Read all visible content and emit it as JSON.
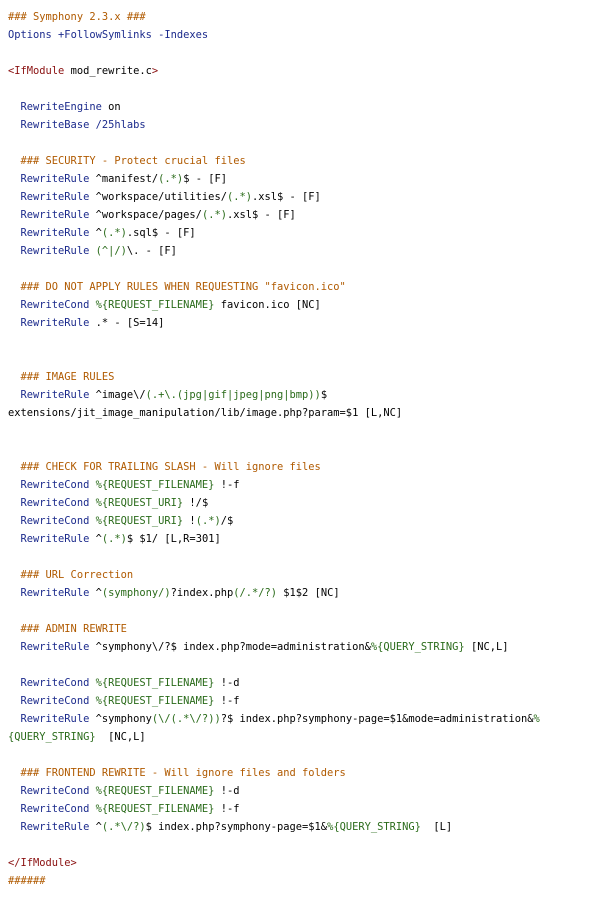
{
  "colors": {
    "comment": "#b05a00",
    "directive": "#1b2a8c",
    "variable": "#2a6b1a",
    "tag": "#8a1010",
    "text": "#000000",
    "background": "#ffffff"
  },
  "lines": [
    [
      {
        "t": "### Symphony 2.3.x ###",
        "c": "c"
      }
    ],
    [
      {
        "t": "Options",
        "c": "d"
      },
      {
        "t": " +FollowSymlinks -Indexes",
        "c": "d"
      }
    ],
    [],
    [
      {
        "t": "<IfModule",
        "c": "k"
      },
      {
        "t": " mod_rewrite.c",
        "c": "p"
      },
      {
        "t": ">",
        "c": "k"
      }
    ],
    [],
    [
      {
        "t": "  RewriteEngine",
        "c": "d"
      },
      {
        "t": " on",
        "c": "p"
      }
    ],
    [
      {
        "t": "  RewriteBase",
        "c": "d"
      },
      {
        "t": " /25hlabs",
        "c": "d"
      }
    ],
    [],
    [
      {
        "t": "  ### SECURITY - Protect crucial files",
        "c": "c"
      }
    ],
    [
      {
        "t": "  RewriteRule",
        "c": "d"
      },
      {
        "t": " ^manifest/",
        "c": "p"
      },
      {
        "t": "(.*)",
        "c": "v"
      },
      {
        "t": "$ - [F]",
        "c": "p"
      }
    ],
    [
      {
        "t": "  RewriteRule",
        "c": "d"
      },
      {
        "t": " ^workspace/utilities/",
        "c": "p"
      },
      {
        "t": "(.*)",
        "c": "v"
      },
      {
        "t": ".xsl$ - [F]",
        "c": "p"
      }
    ],
    [
      {
        "t": "  RewriteRule",
        "c": "d"
      },
      {
        "t": " ^workspace/pages/",
        "c": "p"
      },
      {
        "t": "(.*)",
        "c": "v"
      },
      {
        "t": ".xsl$ - [F]",
        "c": "p"
      }
    ],
    [
      {
        "t": "  RewriteRule",
        "c": "d"
      },
      {
        "t": " ^",
        "c": "p"
      },
      {
        "t": "(.*)",
        "c": "v"
      },
      {
        "t": ".sql$ - [F]",
        "c": "p"
      }
    ],
    [
      {
        "t": "  RewriteRule",
        "c": "d"
      },
      {
        "t": " ",
        "c": "p"
      },
      {
        "t": "(^|/)",
        "c": "v"
      },
      {
        "t": "\\. - [F]",
        "c": "p"
      }
    ],
    [],
    [
      {
        "t": "  ### DO NOT APPLY RULES WHEN REQUESTING \"favicon.ico\"",
        "c": "c"
      }
    ],
    [
      {
        "t": "  RewriteCond",
        "c": "d"
      },
      {
        "t": " %{REQUEST_FILENAME}",
        "c": "v"
      },
      {
        "t": " favicon.ico [NC]",
        "c": "p"
      }
    ],
    [
      {
        "t": "  RewriteRule",
        "c": "d"
      },
      {
        "t": " .* - [S=14]",
        "c": "p"
      }
    ],
    [],
    [],
    [
      {
        "t": "  ### IMAGE RULES",
        "c": "c"
      }
    ],
    [
      {
        "t": "  RewriteRule",
        "c": "d"
      },
      {
        "t": " ^image\\/",
        "c": "p"
      },
      {
        "t": "(.+\\.(jpg|gif|jpeg|png|bmp))",
        "c": "v"
      },
      {
        "t": "$",
        "c": "p"
      }
    ],
    [
      {
        "t": "extensions/jit_image_manipulation/lib/image.php?param=$1 [L,NC]",
        "c": "p"
      }
    ],
    [],
    [],
    [
      {
        "t": "  ### CHECK FOR TRAILING SLASH - Will ignore files",
        "c": "c"
      }
    ],
    [
      {
        "t": "  RewriteCond",
        "c": "d"
      },
      {
        "t": " %{REQUEST_FILENAME}",
        "c": "v"
      },
      {
        "t": " !-f",
        "c": "p"
      }
    ],
    [
      {
        "t": "  RewriteCond",
        "c": "d"
      },
      {
        "t": " %{REQUEST_URI}",
        "c": "v"
      },
      {
        "t": " !/$",
        "c": "p"
      }
    ],
    [
      {
        "t": "  RewriteCond",
        "c": "d"
      },
      {
        "t": " %{REQUEST_URI}",
        "c": "v"
      },
      {
        "t": " !",
        "c": "p"
      },
      {
        "t": "(.*)",
        "c": "v"
      },
      {
        "t": "/$",
        "c": "p"
      }
    ],
    [
      {
        "t": "  RewriteRule",
        "c": "d"
      },
      {
        "t": " ^",
        "c": "p"
      },
      {
        "t": "(.*)",
        "c": "v"
      },
      {
        "t": "$ $1/ [L,R=301]",
        "c": "p"
      }
    ],
    [],
    [
      {
        "t": "  ### URL Correction",
        "c": "c"
      }
    ],
    [
      {
        "t": "  RewriteRule",
        "c": "d"
      },
      {
        "t": " ^",
        "c": "p"
      },
      {
        "t": "(symphony/)",
        "c": "v"
      },
      {
        "t": "?index.php",
        "c": "p"
      },
      {
        "t": "(/.*/?)",
        "c": "v"
      },
      {
        "t": " $1$2 [NC]",
        "c": "p"
      }
    ],
    [],
    [
      {
        "t": "  ### ADMIN REWRITE",
        "c": "c"
      }
    ],
    [
      {
        "t": "  RewriteRule",
        "c": "d"
      },
      {
        "t": " ^symphony\\/?$ index.php?mode=administration&",
        "c": "p"
      },
      {
        "t": "%{QUERY_STRING}",
        "c": "v"
      },
      {
        "t": " [NC,L]",
        "c": "p"
      }
    ],
    [],
    [
      {
        "t": "  RewriteCond",
        "c": "d"
      },
      {
        "t": " %{REQUEST_FILENAME}",
        "c": "v"
      },
      {
        "t": " !-d",
        "c": "p"
      }
    ],
    [
      {
        "t": "  RewriteCond",
        "c": "d"
      },
      {
        "t": " %{REQUEST_FILENAME}",
        "c": "v"
      },
      {
        "t": " !-f",
        "c": "p"
      }
    ],
    [
      {
        "t": "  RewriteRule",
        "c": "d"
      },
      {
        "t": " ^symphony",
        "c": "p"
      },
      {
        "t": "(\\/(.*\\/?))",
        "c": "v"
      },
      {
        "t": "?$ index.php?symphony-page=$1&mode=administration&",
        "c": "p"
      },
      {
        "t": "%",
        "c": "v"
      }
    ],
    [
      {
        "t": "{QUERY_STRING}",
        "c": "v"
      },
      {
        "t": "  [NC,L]",
        "c": "p"
      }
    ],
    [],
    [
      {
        "t": "  ### FRONTEND REWRITE - Will ignore files and folders",
        "c": "c"
      }
    ],
    [
      {
        "t": "  RewriteCond",
        "c": "d"
      },
      {
        "t": " %{REQUEST_FILENAME}",
        "c": "v"
      },
      {
        "t": " !-d",
        "c": "p"
      }
    ],
    [
      {
        "t": "  RewriteCond",
        "c": "d"
      },
      {
        "t": " %{REQUEST_FILENAME}",
        "c": "v"
      },
      {
        "t": " !-f",
        "c": "p"
      }
    ],
    [
      {
        "t": "  RewriteRule",
        "c": "d"
      },
      {
        "t": " ^",
        "c": "p"
      },
      {
        "t": "(.*\\/?)",
        "c": "v"
      },
      {
        "t": "$ index.php?symphony-page=$1&",
        "c": "p"
      },
      {
        "t": "%{QUERY_STRING}",
        "c": "v"
      },
      {
        "t": "  [L]",
        "c": "p"
      }
    ],
    [],
    [
      {
        "t": "</IfModule>",
        "c": "k"
      }
    ],
    [
      {
        "t": "######",
        "c": "c"
      }
    ]
  ]
}
